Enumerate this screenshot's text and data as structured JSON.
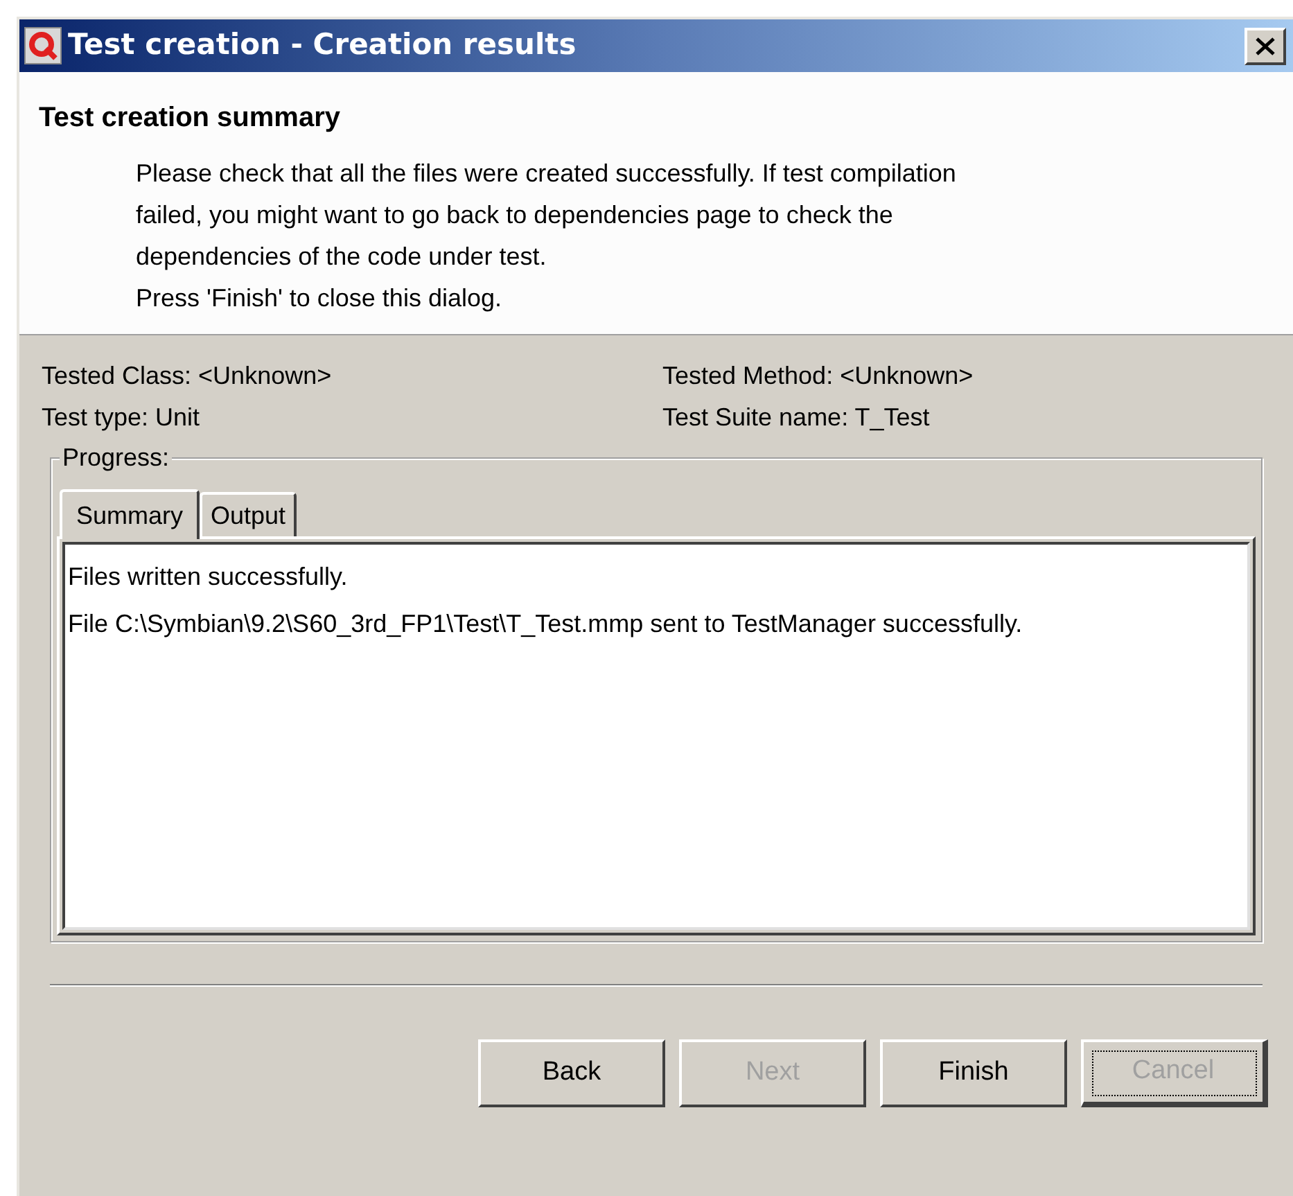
{
  "window": {
    "title": "Test creation - Creation results"
  },
  "header": {
    "title": "Test creation summary",
    "lines": [
      "Please check that all the files were created successfully. If test compilation",
      "failed, you might want to go back to dependencies page to check the",
      "dependencies of the code under test.",
      "Press 'Finish' to close this dialog."
    ]
  },
  "info": [
    {
      "label": "Tested Class: <Unknown>"
    },
    {
      "label": "Tested Method: <Unknown>"
    },
    {
      "label": "Test type: Unit"
    },
    {
      "label": "Test Suite name: T_Test"
    }
  ],
  "progress": {
    "legend": "Progress:",
    "tabs": [
      {
        "label": "Summary",
        "selected": true
      },
      {
        "label": "Output",
        "selected": false
      }
    ],
    "lines": [
      "Files written successfully.",
      "File C:\\Symbian\\9.2\\S60_3rd_FP1\\Test\\T_Test.mmp sent to TestManager successfully."
    ]
  },
  "buttons": [
    {
      "label": "Back",
      "disabled": false,
      "focused": false
    },
    {
      "label": "Next",
      "disabled": true,
      "focused": false
    },
    {
      "label": "Finish",
      "disabled": false,
      "focused": false
    },
    {
      "label": "Cancel",
      "disabled": true,
      "focused": true
    }
  ]
}
